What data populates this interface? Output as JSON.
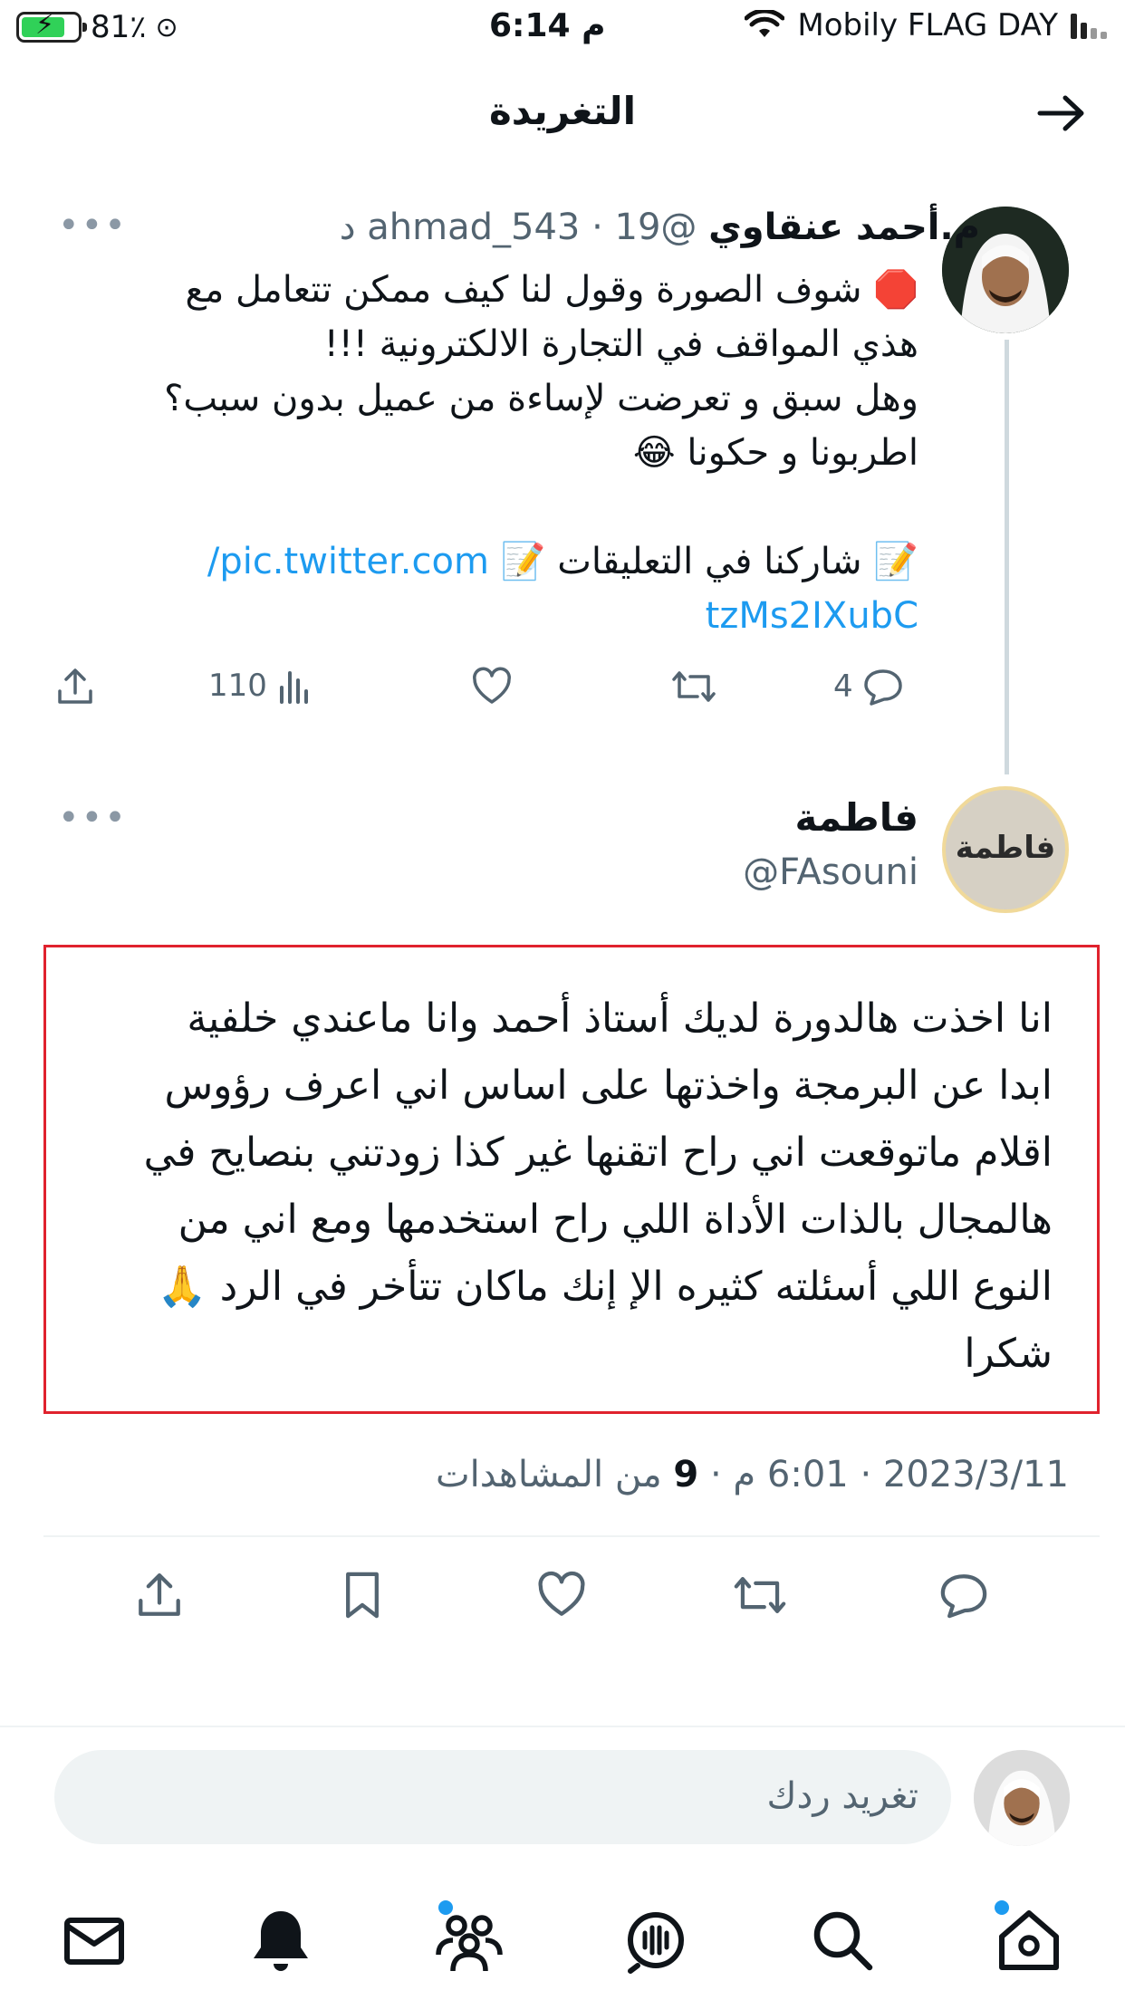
{
  "status_bar": {
    "battery_percent": "81٪",
    "time": "6:14 م",
    "carrier": "Mobily FLAG DAY"
  },
  "header": {
    "title": "التغريدة",
    "back_icon": "arrow-right-icon"
  },
  "parent_tweet": {
    "author_name": "م.أحمد عنقاوي",
    "author_handle": "@ahmad_543",
    "time_ago": "· 19 د",
    "lines": [
      "شوف الصورة وقول لنا كيف ممكن تتعامل مع",
      "هذي المواقف في التجارة الالكترونية !!!",
      "وهل سبق و تعرضت لإساءة من عميل بدون سبب؟",
      "اطربونا و حكونا"
    ],
    "share_line": "شاركنا في التعليقات",
    "link_part1": "pic.twitter.com/",
    "link_part2": "tzMs2IXubC",
    "actions": {
      "replies": "4",
      "retweets": "",
      "likes": "",
      "views": "110"
    }
  },
  "reply_tweet": {
    "author_name": "فاطمة",
    "author_handle": "@FAsouni",
    "avatar_text": "فاطمة",
    "text_lines": [
      "انا اخذت هالدورة لديك أستاذ أحمد وانا ماعندي خلفية",
      "ابدا عن البرمجة واخذتها على اساس اني اعرف رؤوس",
      "اقلام ماتوقعت اني راح اتقنها غير كذا زودتني بنصايح في",
      "هالمجال بالذات الأداة اللي راح استخدمها ومع اني من",
      "النوع اللي أسئلته كثيره الإ إنك ماكان تتأخر في الرد",
      "شكرا"
    ],
    "date": "2023/3/11",
    "time": "6:01 م",
    "views_count": "9",
    "views_label": "من المشاهدات"
  },
  "reply_bar": {
    "placeholder": "تغريد ردك"
  },
  "tab_bar": {
    "items": [
      "home-icon",
      "search-icon",
      "spaces-icon",
      "communities-icon",
      "notifications-icon",
      "messages-icon"
    ]
  },
  "colors": {
    "link": "#1d9bf0",
    "muted": "#536471",
    "highlight_box": "#e0222d",
    "battery": "#30d158"
  }
}
